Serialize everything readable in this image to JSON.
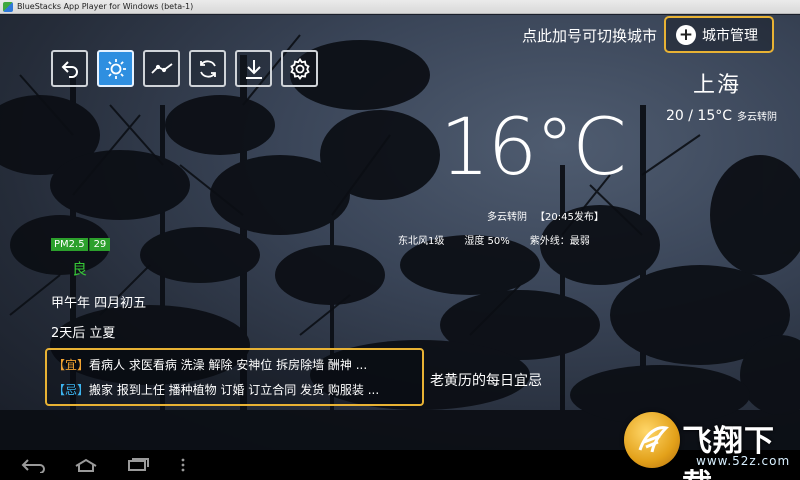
{
  "window": {
    "title": "BlueStacks App Player for Windows (beta-1)"
  },
  "toolbar": {
    "buttons": [
      {
        "icon": "back-icon",
        "active": false
      },
      {
        "icon": "sun-icon",
        "active": true
      },
      {
        "icon": "trend-chart-icon",
        "active": false
      },
      {
        "icon": "refresh-icon",
        "active": false
      },
      {
        "icon": "download-icon",
        "active": false
      },
      {
        "icon": "gear-icon",
        "active": false
      }
    ]
  },
  "city": {
    "hint": "点此加号可切换城市",
    "manage_label": "城市管理",
    "name": "上海",
    "range": "20 / 15°C",
    "range_desc": "多云转阴"
  },
  "current": {
    "temperature": "16°C",
    "condition": "多云转阴",
    "published": "【20:45发布】",
    "wind": "东北风1级",
    "humidity": "湿度 50%",
    "uv": "紫外线：最弱"
  },
  "air": {
    "label": "PM2.5",
    "value": "29",
    "quality": "良",
    "quality_color": "#36c736"
  },
  "lunar": {
    "date": "甲午年 四月初五",
    "solar_term": "2天后 立夏"
  },
  "almanac": {
    "yi_tag": "【宜】",
    "yi_text": "看病人 求医看病 洗澡 解除 安神位 拆房除墙 酬神 ...",
    "ji_tag": "【忌】",
    "ji_text": "搬家 报到上任 播种植物 订婚 订立合同 发货 购服装 ...",
    "caption": "老黄历的每日宜忌",
    "border_color": "#e8b234"
  },
  "navbar": {
    "buttons": [
      "back-icon",
      "home-icon",
      "recent-apps-icon",
      "menu-dots-icon"
    ]
  },
  "watermark": {
    "title": "飞翔下载",
    "url": "www.52z.com"
  }
}
